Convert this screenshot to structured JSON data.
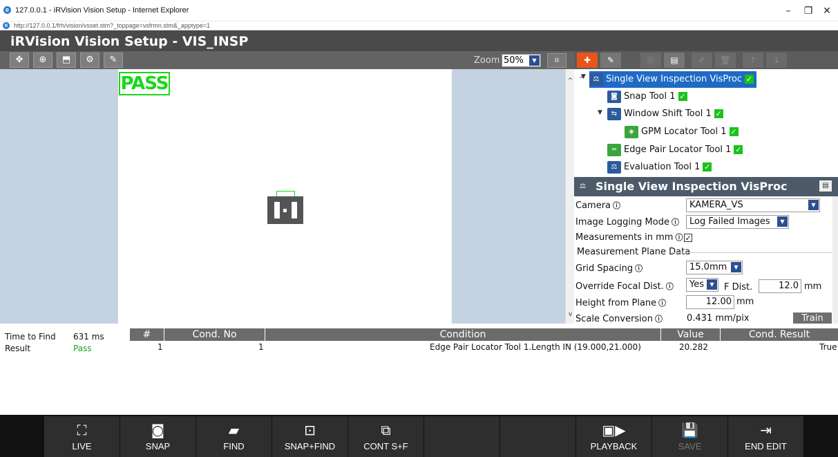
{
  "browser": {
    "window_title": "127.0.0.1 - iRVision Vision Setup - Internet Explorer",
    "url": "http://127.0.0.1/frh/vision/vsset.stm?_toppage=vsfrmn.stm&_apptype=1",
    "controls": {
      "minimize": "–",
      "restore": "❐",
      "close": "✕"
    }
  },
  "app": {
    "title": "iRVision Vision Setup - VIS_INSP"
  },
  "toolbar": {
    "zoom_label": "Zoom",
    "zoom_value": "50%",
    "buttons": [
      "move-icon",
      "zoom-in-icon",
      "save-image-icon",
      "camera-settings-icon",
      "color-picker-icon"
    ]
  },
  "image": {
    "status": "PASS"
  },
  "tree": {
    "items": [
      {
        "label": "Single View Inspection VisProc",
        "icon": "inspection-icon",
        "selected": true,
        "checked": true
      },
      {
        "label": "Snap Tool 1",
        "icon": "snap-icon",
        "checked": true
      },
      {
        "label": "Window Shift Tool 1",
        "icon": "window-shift-icon",
        "checked": true
      },
      {
        "label": "GPM Locator Tool 1",
        "icon": "gpm-icon",
        "checked": true
      },
      {
        "label": "Edge Pair Locator Tool 1",
        "icon": "edge-pair-icon",
        "checked": true
      },
      {
        "label": "Evaluation Tool 1",
        "icon": "evaluation-icon",
        "checked": true
      }
    ]
  },
  "properties": {
    "title": "Single View Inspection VisProc",
    "camera_label": "Camera",
    "camera_value": "KAMERA_VS",
    "logging_label": "Image Logging Mode",
    "logging_value": "Log Failed Images",
    "mm_label": "Measurements in mm",
    "mm_checked": true,
    "plane_section": "Measurement Plane Data",
    "grid_label": "Grid Spacing",
    "grid_value": "15.0mm",
    "focal_label": "Override Focal Dist.",
    "focal_value": "Yes",
    "fdist_label": "F Dist.",
    "fdist_value": "12.0",
    "fdist_unit": "mm",
    "height_label": "Height from Plane",
    "height_value": "12.00",
    "height_unit": "mm",
    "scale_label": "Scale Conversion",
    "scale_value": "0.431  mm/pix",
    "train_label": "Train"
  },
  "results": {
    "time_label": "Time to Find",
    "time_value": "631 ms",
    "result_label": "Result",
    "result_value": "Pass",
    "columns": [
      "#",
      "Cond. No",
      "Condition",
      "Value",
      "Cond. Result"
    ],
    "rows": [
      {
        "num": "1",
        "cond_no": "1",
        "condition": "Edge Pair Locator Tool 1.Length IN (19.000,21.000)",
        "value": "20.282",
        "result": "True"
      }
    ]
  },
  "bottom_bar": {
    "buttons": [
      {
        "label": "LIVE",
        "icon": "live-icon"
      },
      {
        "label": "SNAP",
        "icon": "snap-icon"
      },
      {
        "label": "FIND",
        "icon": "find-icon"
      },
      {
        "label": "SNAP+FIND",
        "icon": "snap-find-icon"
      },
      {
        "label": "CONT S+F",
        "icon": "cont-icon"
      },
      {
        "label": "",
        "icon": ""
      },
      {
        "label": "",
        "icon": ""
      },
      {
        "label": "PLAYBACK",
        "icon": "playback-icon"
      },
      {
        "label": "SAVE",
        "icon": "save-icon"
      },
      {
        "label": "END EDIT",
        "icon": "end-edit-icon"
      }
    ]
  }
}
